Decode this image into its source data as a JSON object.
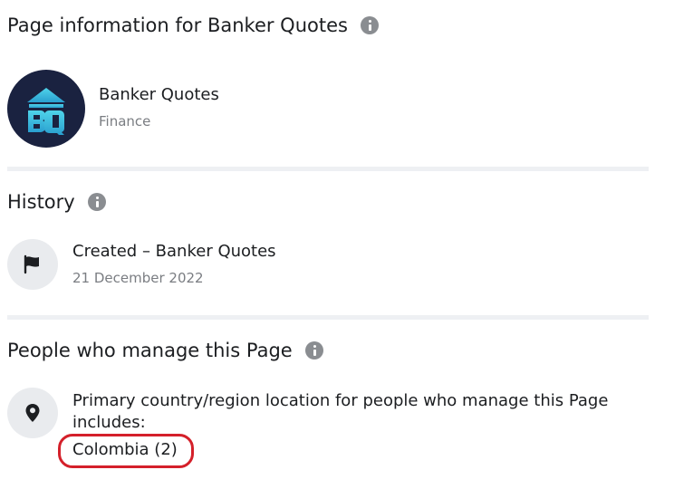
{
  "page_info": {
    "title": "Page information for Banker Quotes",
    "page_name": "Banker Quotes",
    "category": "Finance",
    "avatar_monogram": "BQ",
    "icons": [
      "info-icon",
      "logo"
    ]
  },
  "history": {
    "title": "History",
    "event_title": "Created – Banker Quotes",
    "event_date": "21 December 2022",
    "icons": [
      "info-icon",
      "flag-icon"
    ]
  },
  "managers": {
    "title": "People who manage this Page",
    "location_text": "Primary country/region location for people who manage this Page includes:",
    "country": "Colombia (2)",
    "icons": [
      "info-icon",
      "location-pin-icon"
    ]
  },
  "colors": {
    "highlight": "#d4202a",
    "avatar_bg": "#1a2240",
    "logo_gradient_start": "#3ec6e0",
    "logo_gradient_end": "#27a3c9"
  }
}
